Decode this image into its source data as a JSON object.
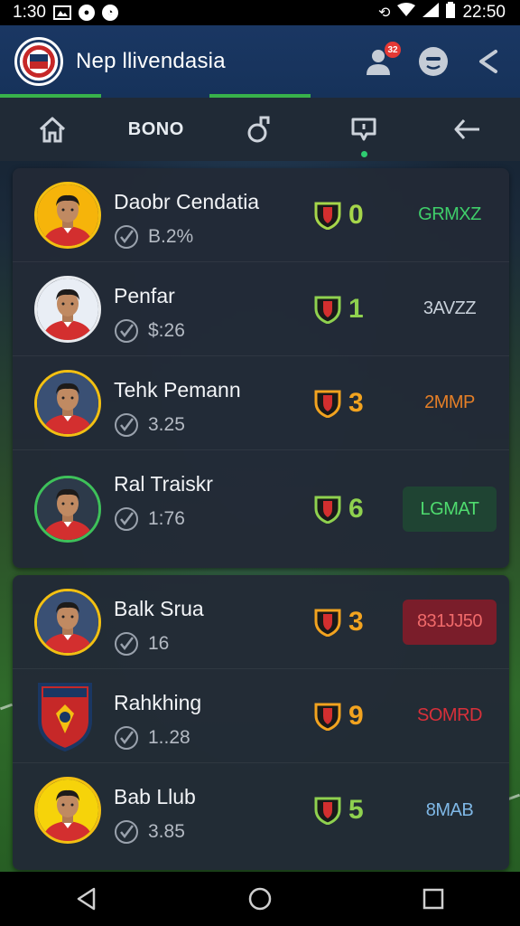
{
  "status_bar": {
    "time": "1:30",
    "clock": "22:50"
  },
  "app": {
    "title": "Nep llivendasia",
    "notification_count": "32"
  },
  "tabs": [
    {
      "icon": "home-icon",
      "label": ""
    },
    {
      "icon": "",
      "label": "BONO"
    },
    {
      "icon": "whistle-icon",
      "label": ""
    },
    {
      "icon": "chat-icon",
      "label": "",
      "active": true
    },
    {
      "icon": "reply-icon",
      "label": ""
    }
  ],
  "players_group_1": [
    {
      "name": "Daobr Cendatia",
      "value": "B.2%",
      "score": "0",
      "score_color": "#a6d64a",
      "code": "GRMXZ",
      "code_color": "#3fcf6a",
      "code_bg": "transparent",
      "avatar_ring": "#f3c012",
      "avatar_bg": "#f6b40a"
    },
    {
      "name": "Penfar",
      "value": "$:26",
      "score": "1",
      "score_color": "#8fd14f",
      "code": "3AVZZ",
      "code_color": "#c8d0da",
      "code_bg": "transparent",
      "avatar_ring": "#e8ebef",
      "avatar_bg": "#e9eef5"
    },
    {
      "name": "Tehk Pemann",
      "value": "3.25",
      "score": "3",
      "score_color": "#f2a31f",
      "code": "2MMP",
      "code_color": "#e57f27",
      "code_bg": "transparent",
      "avatar_ring": "#f3c012",
      "avatar_bg": "#3a5074"
    },
    {
      "name": "Ral Traiskr",
      "value": "1:76",
      "score": "6",
      "score_color": "#8fd14f",
      "code": "LGMAT",
      "code_color": "#4fdc6f",
      "code_bg": "#1f4433",
      "avatar_ring": "#3ec15a",
      "avatar_bg": "#2d3a4a"
    }
  ],
  "players_group_2": [
    {
      "name": "Balk Srua",
      "value": "16",
      "score": "3",
      "score_color": "#f2a31f",
      "code": "831JJ50",
      "code_color": "#f06a6a",
      "code_bg": "#7a1d2a",
      "avatar_ring": "#f3c012",
      "avatar_bg": "#3a5074"
    },
    {
      "name": "Rahkhing",
      "value": "1..28",
      "score": "9",
      "score_color": "#f2a31f",
      "code": "SOMRD",
      "code_color": "#d8303a",
      "code_bg": "transparent",
      "avatar_ring": "transparent",
      "avatar_bg": "transparent",
      "is_crest": true
    },
    {
      "name": "Bab Llub",
      "value": "3.85",
      "score": "5",
      "score_color": "#8fd14f",
      "code": "8MAB",
      "code_color": "#7fb8e6",
      "code_bg": "transparent",
      "avatar_ring": "#f3c012",
      "avatar_bg": "#f6d30a"
    }
  ],
  "colors": {
    "app_bar": "#1a3763",
    "tab_bar": "#202a36",
    "card": "#222a36",
    "accent": "#38b24a"
  }
}
